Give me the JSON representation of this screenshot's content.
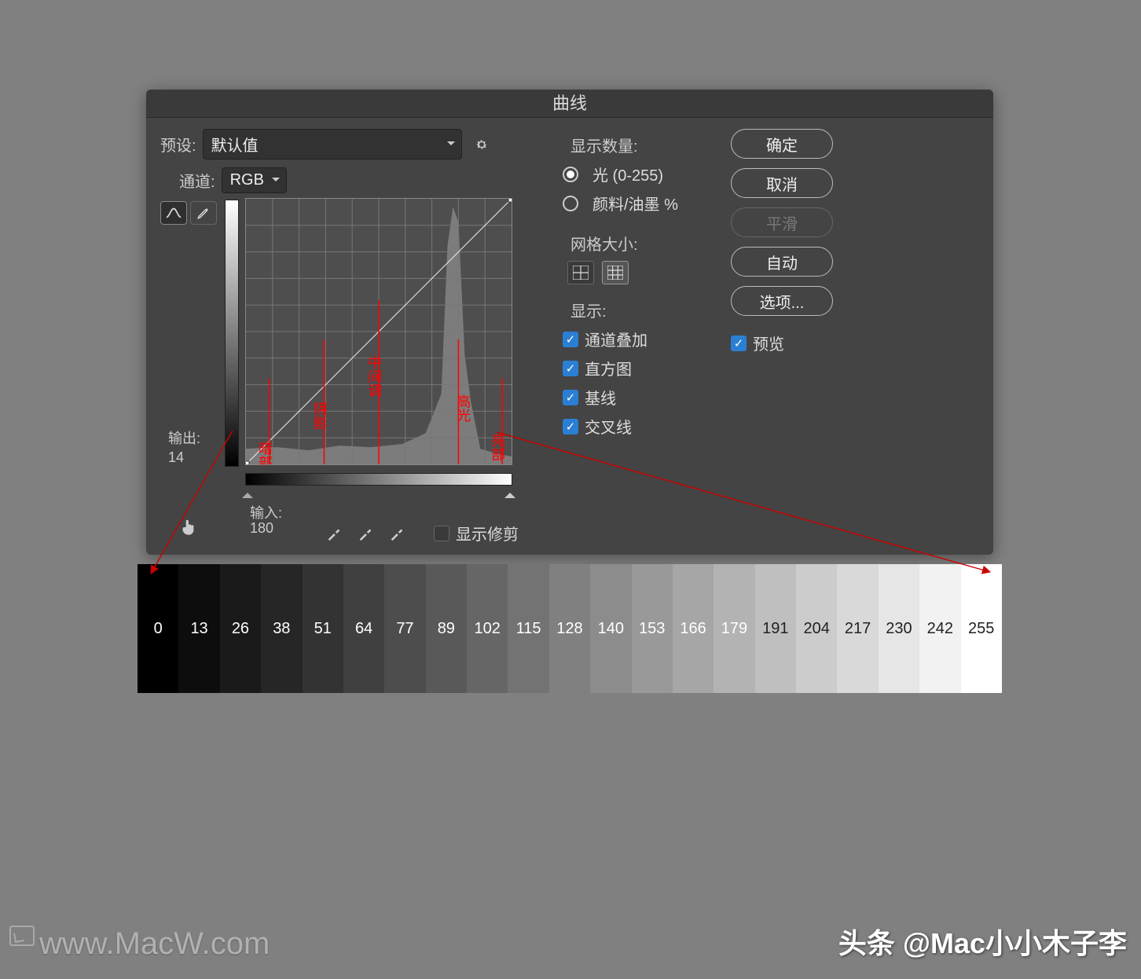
{
  "dialog": {
    "title": "曲线",
    "preset_label": "预设:",
    "preset_value": "默认值",
    "channel_label": "通道:",
    "channel_value": "RGB",
    "output_label": "输出:",
    "output_value": "14",
    "input_label": "输入:",
    "input_value": "180",
    "show_clipping_label": "显示修剪",
    "show_clipping_checked": false,
    "annotations": {
      "shadow_zone": "暗部",
      "shadow": "阴影",
      "midtone": "中间调",
      "highlight": "高光",
      "bright_zone": "亮部"
    }
  },
  "options": {
    "display_amount_label": "显示数量:",
    "radio_light": "光 (0-255)",
    "radio_ink": "颜料/油墨 %",
    "radio_light_selected": true,
    "grid_size_label": "网格大小:",
    "show_label": "显示:",
    "checks": {
      "channel_overlay": "通道叠加",
      "histogram": "直方图",
      "baseline": "基线",
      "cross": "交叉线"
    }
  },
  "buttons": {
    "ok": "确定",
    "cancel": "取消",
    "smooth": "平滑",
    "auto": "自动",
    "options": "选项...",
    "preview": "预览",
    "preview_checked": true
  },
  "gradient_values": [
    0,
    13,
    26,
    38,
    51,
    64,
    77,
    89,
    102,
    115,
    128,
    140,
    153,
    166,
    179,
    191,
    204,
    217,
    230,
    242,
    255
  ],
  "watermark_left": "www.MacW.com",
  "watermark_right": "头条 @Mac小小木子李"
}
